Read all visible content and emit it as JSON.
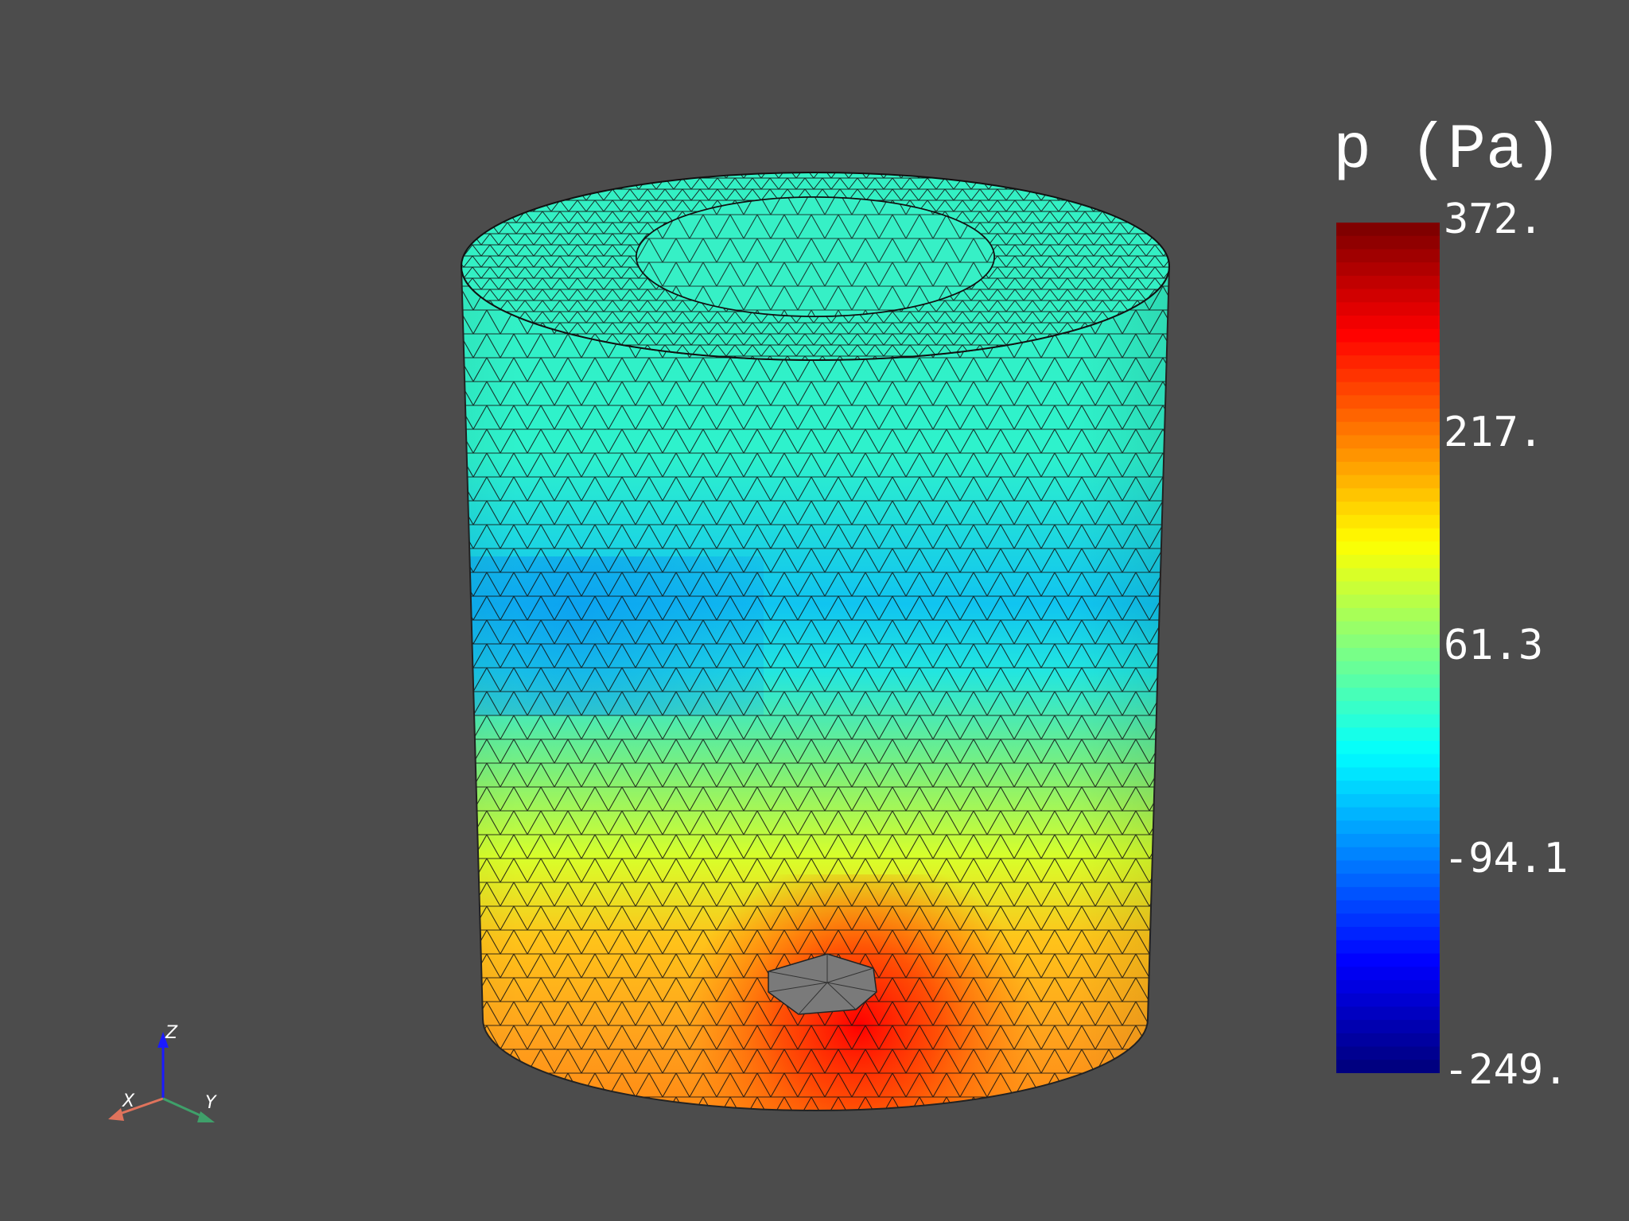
{
  "viewport": {
    "background": "#4c4c4c",
    "field": "p (Pa)",
    "mesh": "triangulated hollow cylinder"
  },
  "scalar_bar": {
    "title": "p (Pa)",
    "ticks": [
      "372.",
      "217.",
      "61.3",
      "-94.1",
      "-249."
    ],
    "range": [
      -249,
      372
    ],
    "colormap": "jet",
    "colors": [
      "#800000",
      "#ff0000",
      "#ff8000",
      "#ffff00",
      "#80ff80",
      "#00ffff",
      "#0080ff",
      "#0000ff",
      "#000080"
    ]
  },
  "orientation_axes": {
    "x_label": "X",
    "y_label": "Y",
    "z_label": "Z",
    "x_color": "#e0735c",
    "y_color": "#3fa06a",
    "z_color": "#1a1aff"
  },
  "surface_colors": {
    "top": "#33f0c4",
    "band_low": "#12c8f0",
    "mid": "#7cf56f",
    "yellow": "#e6ff1a",
    "orange": "#ffa21c",
    "hot": "#ff1a00",
    "patch": "#7a7a7a"
  }
}
